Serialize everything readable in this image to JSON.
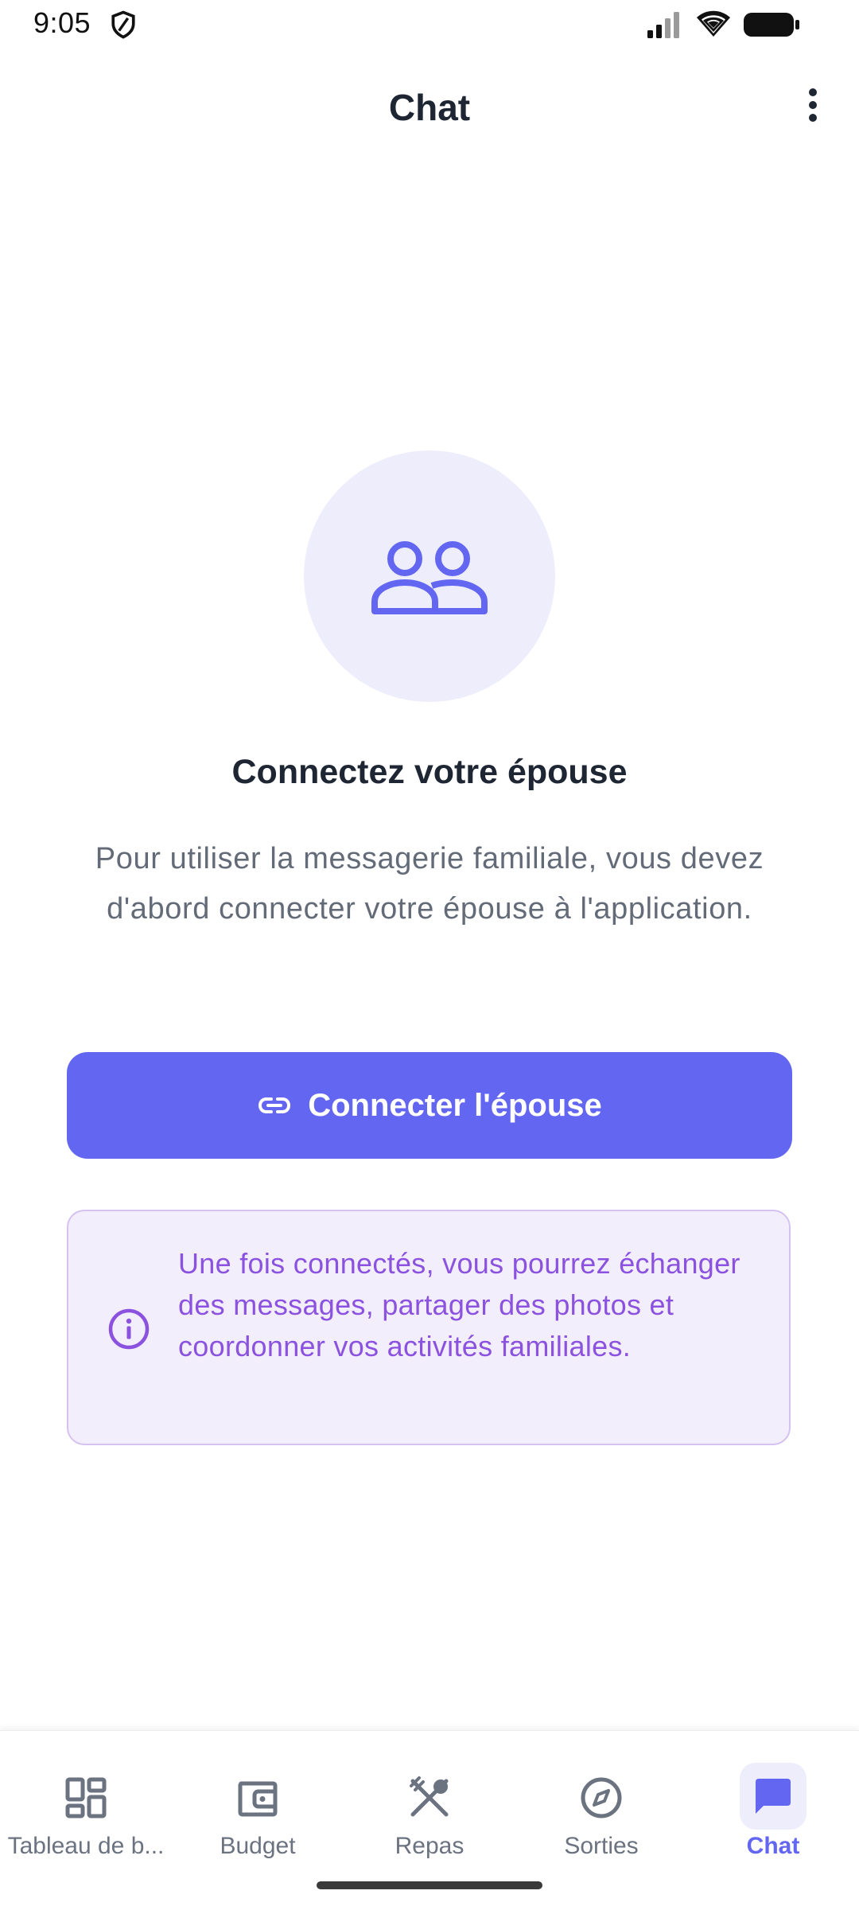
{
  "status_bar": {
    "time": "9:05",
    "icons": [
      "shield-icon",
      "signal-icon",
      "wifi-icon",
      "battery-icon"
    ]
  },
  "app_bar": {
    "title": "Chat",
    "menu_icon": "more-vert-icon"
  },
  "empty_state": {
    "icon": "people-icon",
    "heading": "Connectez votre épouse",
    "description": "Pour utiliser la messagerie familiale, vous devez d'abord connecter votre épouse à l'application.",
    "button_label": "Connecter l'épouse",
    "button_icon": "link-icon",
    "info_text": "Une fois connectés, vous pourrez échanger des messages, partager des photos et coordonner vos activités familiales.",
    "info_icon": "info-icon"
  },
  "bottom_nav": {
    "items": [
      {
        "label": "Tableau de b...",
        "icon": "dashboard-icon",
        "active": false
      },
      {
        "label": "Budget",
        "icon": "wallet-icon",
        "active": false
      },
      {
        "label": "Repas",
        "icon": "utensils-icon",
        "active": false
      },
      {
        "label": "Sorties",
        "icon": "compass-icon",
        "active": false
      },
      {
        "label": "Chat",
        "icon": "chat-icon",
        "active": true
      }
    ]
  },
  "colors": {
    "primary": "#6366f1",
    "primary_light": "#eeedfc",
    "heading": "#1e2533",
    "muted": "#646b78",
    "info_text": "#8b52e0",
    "info_bg": "#f3eefc",
    "info_border": "#d4c2f2"
  }
}
